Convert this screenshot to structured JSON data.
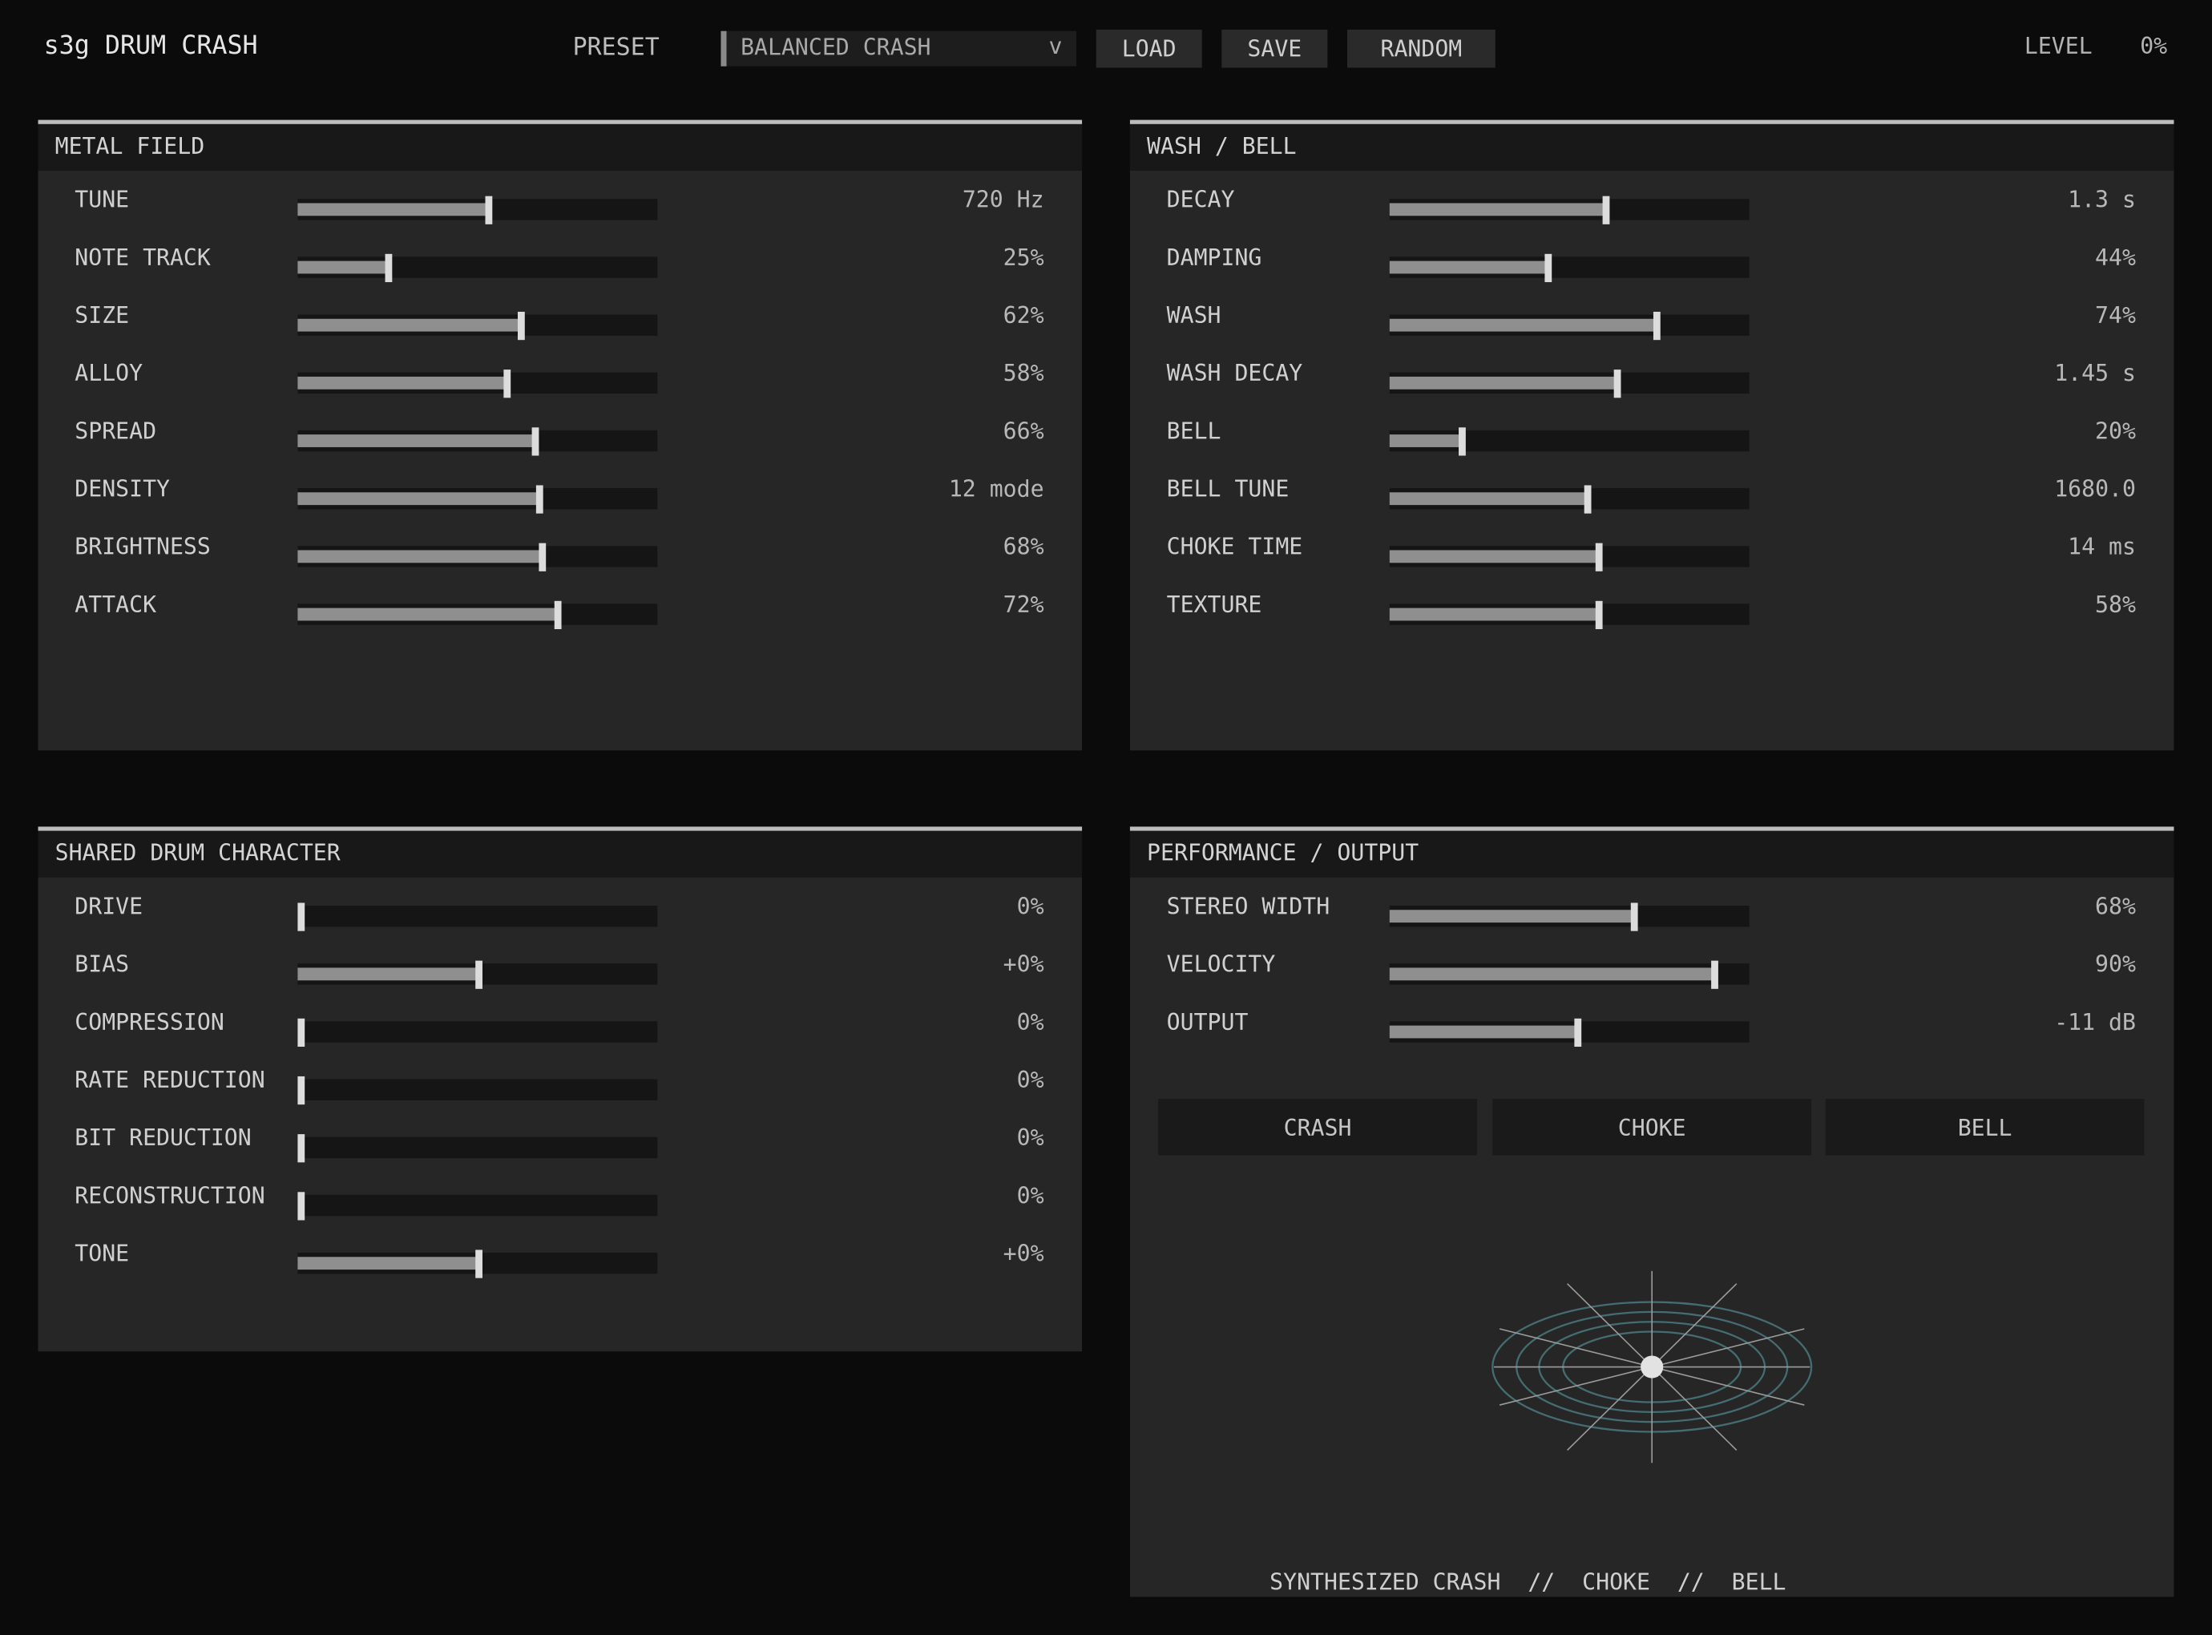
{
  "app": {
    "title": "s3g DRUM CRASH"
  },
  "preset": {
    "label": "PRESET",
    "value": "BALANCED CRASH",
    "chevron": "v"
  },
  "toolbar": {
    "load": "LOAD",
    "save": "SAVE",
    "random": "RANDOM"
  },
  "level": {
    "label": "LEVEL",
    "value": "0%"
  },
  "metal": {
    "title": "METAL FIELD",
    "rows": [
      {
        "label": "TUNE",
        "value": "720 Hz",
        "pos": 0.53
      },
      {
        "label": "NOTE TRACK",
        "value": "25%",
        "pos": 0.25
      },
      {
        "label": "SIZE",
        "value": "62%",
        "pos": 0.62
      },
      {
        "label": "ALLOY",
        "value": "58%",
        "pos": 0.58
      },
      {
        "label": "SPREAD",
        "value": "66%",
        "pos": 0.66
      },
      {
        "label": "DENSITY",
        "value": "12 mode",
        "pos": 0.67
      },
      {
        "label": "BRIGHTNESS",
        "value": "68%",
        "pos": 0.68
      },
      {
        "label": "ATTACK",
        "value": "72%",
        "pos": 0.72
      }
    ]
  },
  "wash": {
    "title": "WASH / BELL",
    "rows": [
      {
        "label": "DECAY",
        "value": "1.3 s",
        "pos": 0.6
      },
      {
        "label": "DAMPING",
        "value": "44%",
        "pos": 0.44
      },
      {
        "label": "WASH",
        "value": "74%",
        "pos": 0.74
      },
      {
        "label": "WASH DECAY",
        "value": "1.45 s",
        "pos": 0.63
      },
      {
        "label": "BELL",
        "value": "20%",
        "pos": 0.2
      },
      {
        "label": "BELL TUNE",
        "value": "1680.0",
        "pos": 0.55
      },
      {
        "label": "CHOKE TIME",
        "value": "14 ms",
        "pos": 0.58
      },
      {
        "label": "TEXTURE",
        "value": "58%",
        "pos": 0.58
      }
    ]
  },
  "shared": {
    "title": "SHARED DRUM CHARACTER",
    "rows": [
      {
        "label": "DRIVE",
        "value": "0%",
        "pos": 0.0
      },
      {
        "label": "BIAS",
        "value": "+0%",
        "pos": 0.5
      },
      {
        "label": "COMPRESSION",
        "value": "0%",
        "pos": 0.0
      },
      {
        "label": "RATE REDUCTION",
        "value": "0%",
        "pos": 0.0
      },
      {
        "label": "BIT REDUCTION",
        "value": "0%",
        "pos": 0.0
      },
      {
        "label": "RECONSTRUCTION",
        "value": "0%",
        "pos": 0.0
      },
      {
        "label": "TONE",
        "value": "+0%",
        "pos": 0.5
      }
    ]
  },
  "perf": {
    "title": "PERFORMANCE / OUTPUT",
    "rows": [
      {
        "label": "STEREO WIDTH",
        "value": "68%",
        "pos": 0.68
      },
      {
        "label": "VELOCITY",
        "value": "90%",
        "pos": 0.9
      },
      {
        "label": "OUTPUT",
        "value": "-11 dB",
        "pos": 0.52
      }
    ],
    "pads": [
      "CRASH",
      "CHOKE",
      "BELL"
    ],
    "footer": "SYNTHESIZED CRASH  //  CHOKE  //  BELL"
  },
  "colors": {
    "accent": "#4a7a80",
    "panel": "#262626",
    "fill": "#8f8f8f"
  }
}
